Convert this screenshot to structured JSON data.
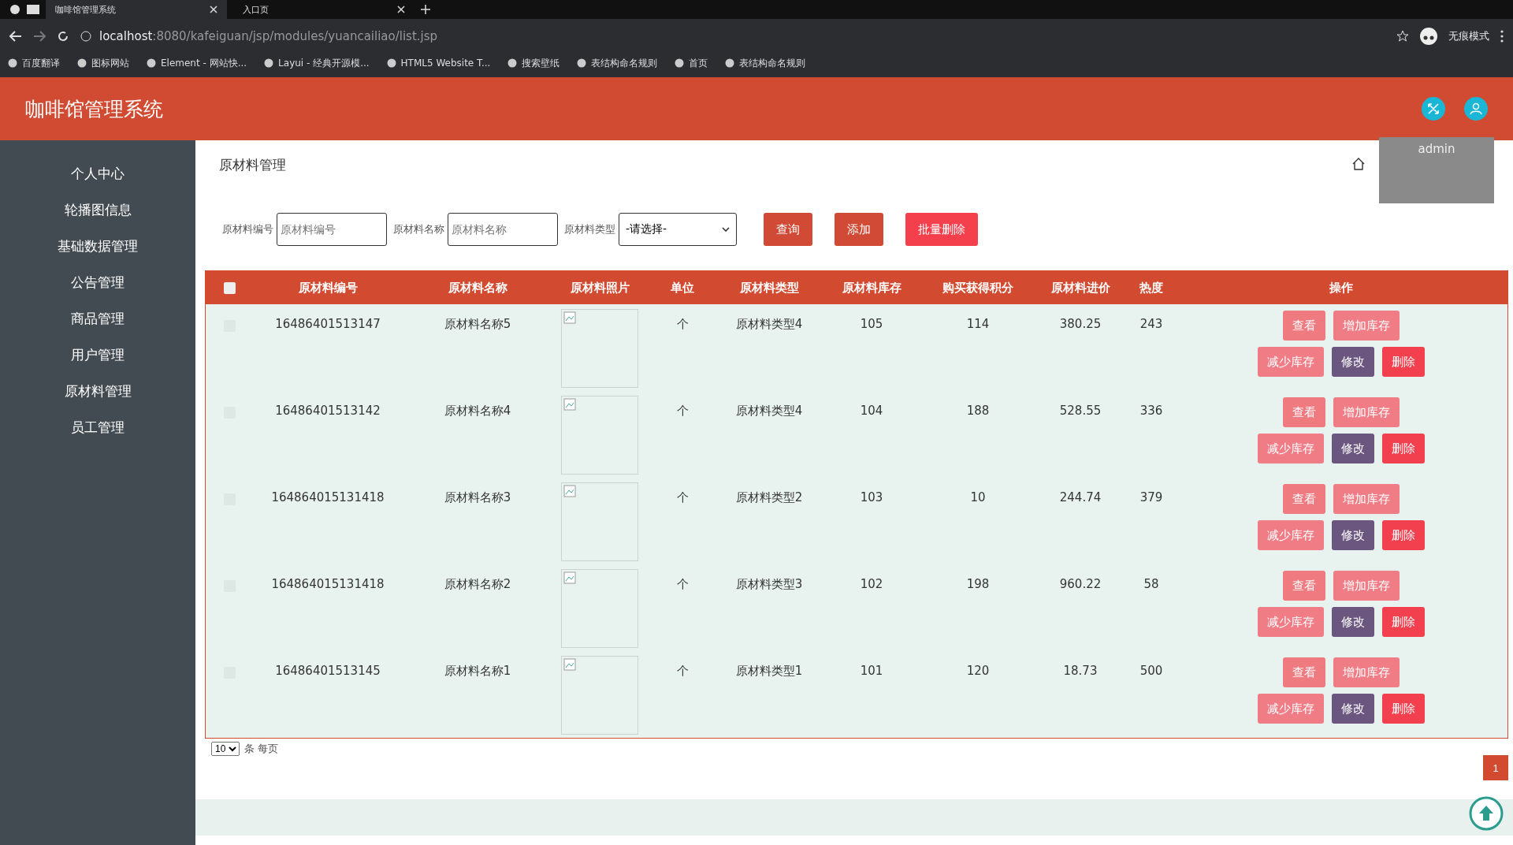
{
  "browser": {
    "tabs": [
      {
        "label": "咖啡馆管理系统",
        "selected": true
      },
      {
        "label": "入口页",
        "selected": false
      }
    ],
    "address": {
      "host": "localhost",
      "path": ":8080/kafeiguan/jsp/modules/yuancailiao/list.jsp"
    },
    "profile": "无痕模式",
    "bookmarks": [
      "百度翻译",
      "图标网站",
      "Element - 网站快...",
      "Layui - 经典开源模...",
      "HTML5 Website T...",
      "搜索壁纸",
      "表结构命名规则",
      "首页",
      "表结构命名规则"
    ]
  },
  "header": {
    "title": "咖啡馆管理系统",
    "user_menu": {
      "name": "admin"
    }
  },
  "sidebar": {
    "items": [
      "个人中心",
      "轮播图信息",
      "基础数据管理",
      "公告管理",
      "商品管理",
      "用户管理",
      "原材料管理",
      "员工管理"
    ]
  },
  "page": {
    "title": "原材料管理"
  },
  "search": {
    "fields": [
      {
        "kind": "input",
        "label": "原材料编号",
        "placeholder": "原材料编号"
      },
      {
        "kind": "input",
        "label": "原材料名称",
        "placeholder": "原材料名称"
      },
      {
        "kind": "select",
        "label": "原材料类型",
        "value": "-请选择-"
      }
    ],
    "buttons": [
      {
        "label": "查询",
        "kind": "primary"
      },
      {
        "label": "添加",
        "kind": "primary"
      },
      {
        "label": "批量删除",
        "kind": "danger"
      }
    ]
  },
  "table": {
    "select_all_checked": false,
    "columns": [
      "原材料编号",
      "原材料名称",
      "原材料照片",
      "单位",
      "原材料类型",
      "原材料库存",
      "购买获得积分",
      "原材料进价",
      "热度",
      "操作"
    ],
    "rows": [
      {
        "checked": false,
        "cells": [
          "16486401513147",
          "原材料名称5",
          "",
          "个",
          "原材料类型4",
          "105",
          "114",
          "380.25",
          "243"
        ],
        "actions": [
          {
            "label": "查看",
            "kind": "view"
          },
          {
            "label": "增加库存",
            "kind": "add"
          },
          {
            "label": "减少库存",
            "kind": "reduce"
          },
          {
            "label": "修改",
            "kind": "edit"
          },
          {
            "label": "删除",
            "kind": "delete"
          }
        ]
      },
      {
        "checked": false,
        "cells": [
          "16486401513142",
          "原材料名称4",
          "",
          "个",
          "原材料类型4",
          "104",
          "188",
          "528.55",
          "336"
        ],
        "actions": [
          {
            "label": "查看",
            "kind": "view"
          },
          {
            "label": "增加库存",
            "kind": "add"
          },
          {
            "label": "减少库存",
            "kind": "reduce"
          },
          {
            "label": "修改",
            "kind": "edit"
          },
          {
            "label": "删除",
            "kind": "delete"
          }
        ]
      },
      {
        "checked": false,
        "cells": [
          "164864015131418",
          "原材料名称3",
          "",
          "个",
          "原材料类型2",
          "103",
          "10",
          "244.74",
          "379"
        ],
        "actions": [
          {
            "label": "查看",
            "kind": "view"
          },
          {
            "label": "增加库存",
            "kind": "add"
          },
          {
            "label": "减少库存",
            "kind": "reduce"
          },
          {
            "label": "修改",
            "kind": "edit"
          },
          {
            "label": "删除",
            "kind": "delete"
          }
        ]
      },
      {
        "checked": false,
        "cells": [
          "164864015131418",
          "原材料名称2",
          "",
          "个",
          "原材料类型3",
          "102",
          "198",
          "960.22",
          "58"
        ],
        "actions": [
          {
            "label": "查看",
            "kind": "view"
          },
          {
            "label": "增加库存",
            "kind": "add"
          },
          {
            "label": "减少库存",
            "kind": "reduce"
          },
          {
            "label": "修改",
            "kind": "edit"
          },
          {
            "label": "删除",
            "kind": "delete"
          }
        ]
      },
      {
        "checked": false,
        "cells": [
          "16486401513145",
          "原材料名称1",
          "",
          "个",
          "原材料类型1",
          "101",
          "120",
          "18.73",
          "500"
        ],
        "actions": [
          {
            "label": "查看",
            "kind": "view"
          },
          {
            "label": "增加库存",
            "kind": "add"
          },
          {
            "label": "减少库存",
            "kind": "reduce"
          },
          {
            "label": "修改",
            "kind": "edit"
          },
          {
            "label": "删除",
            "kind": "delete"
          }
        ]
      }
    ]
  },
  "pagination": {
    "page_size": "10",
    "page_size_label": "条 每页",
    "pages": [
      {
        "label": "1",
        "selected": true
      }
    ]
  }
}
